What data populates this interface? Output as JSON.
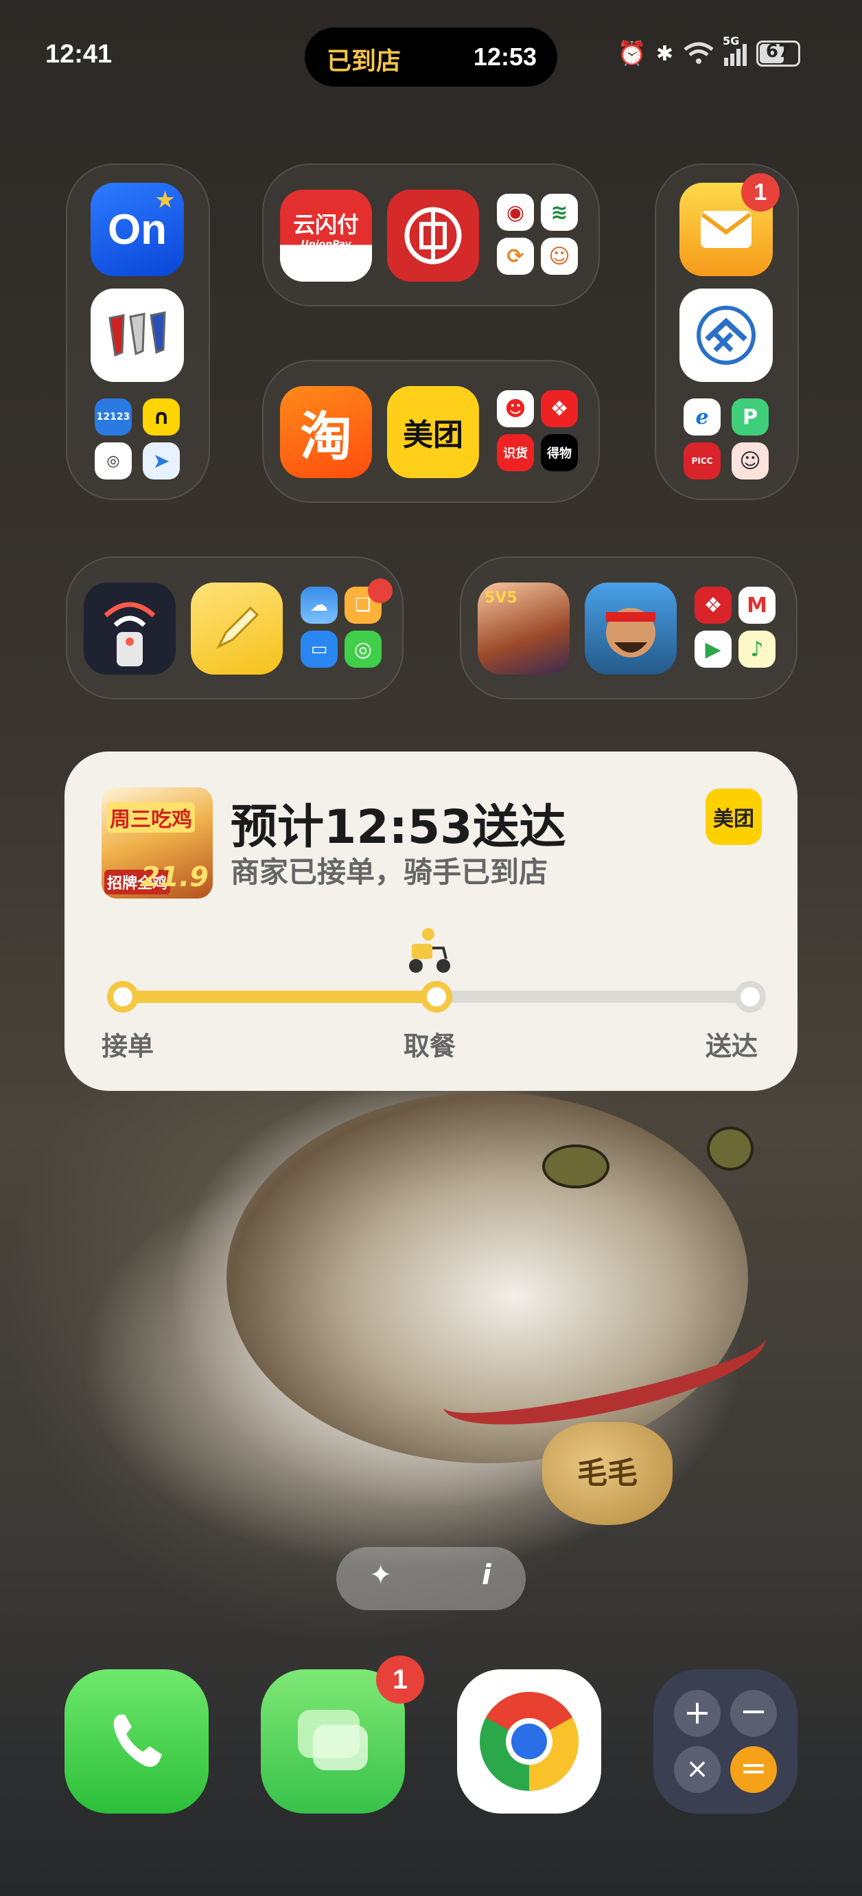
{
  "status_bar": {
    "time": "12:41",
    "island_label": "已到店",
    "island_time": "12:53",
    "signal_label": "5G",
    "battery": "67"
  },
  "folder_a": {
    "app1": "On",
    "app5": "12123"
  },
  "folder_b": {
    "unionpay": "云闪付",
    "unionpay_sub": "UnionPay"
  },
  "folder_c": {
    "taobao": "淘",
    "meituan": "美团",
    "mini3": "识货",
    "mini4": "得物"
  },
  "folder_d": {
    "mail_badge": "1",
    "picc": "PICC"
  },
  "folder_f": {
    "game1": "5V5"
  },
  "delivery": {
    "thumb_title": "周三吃鸡",
    "thumb_promo": "招牌全鸡",
    "thumb_price": "21.9",
    "title": "预计12:53送达",
    "subtitle": "商家已接单，骑手已到店",
    "logo": "美团",
    "steps": [
      "接单",
      "取餐",
      "送达"
    ],
    "progress": 0.5
  },
  "pill": {
    "left_icon": "sparkle-icon",
    "right_icon": "info-icon",
    "right_text": "i"
  },
  "dock": {
    "messages_badge": "1"
  },
  "wallpaper": {
    "tag_text": "毛毛"
  }
}
